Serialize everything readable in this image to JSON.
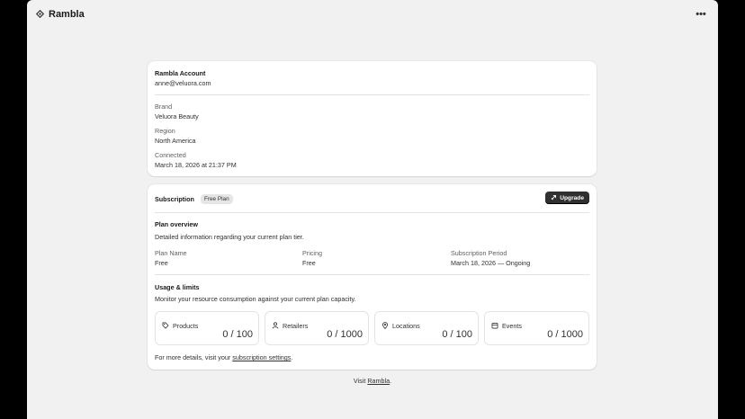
{
  "app": {
    "title": "Rambla",
    "more_label": "•••"
  },
  "account": {
    "title": "Rambla Account",
    "email": "anne@veluora.com",
    "fields": [
      {
        "label": "Brand",
        "value": "Veluora Beauty"
      },
      {
        "label": "Region",
        "value": "North America"
      },
      {
        "label": "Connected",
        "value": "March 18, 2026 at 21:37 PM"
      }
    ]
  },
  "subscription": {
    "title": "Subscription",
    "badge": "Free Plan",
    "upgrade_label": "Upgrade",
    "overview": {
      "title": "Plan overview",
      "description": "Detailed information regarding your current plan tier.",
      "plan_name_label": "Plan Name",
      "plan_name_value": "Free",
      "pricing_label": "Pricing",
      "pricing_value": "Free",
      "period_label": "Subscription Period",
      "period_value": "March 18, 2026 — Ongoing"
    },
    "usage": {
      "title": "Usage & limits",
      "description": "Monitor your resource consumption against your current plan capacity.",
      "items": [
        {
          "label": "Products",
          "value": "0 / 100",
          "icon": "tag-icon"
        },
        {
          "label": "Retailers",
          "value": "0 / 1000",
          "icon": "person-icon"
        },
        {
          "label": "Locations",
          "value": "0 / 100",
          "icon": "location-pin-icon"
        },
        {
          "label": "Events",
          "value": "0 / 1000",
          "icon": "calendar-icon"
        }
      ]
    },
    "details": {
      "prefix": "For more details, visit your",
      "link": "subscription settings",
      "suffix": "."
    }
  },
  "footer": {
    "prefix": "Visit",
    "link": "Rambla",
    "suffix": "."
  }
}
